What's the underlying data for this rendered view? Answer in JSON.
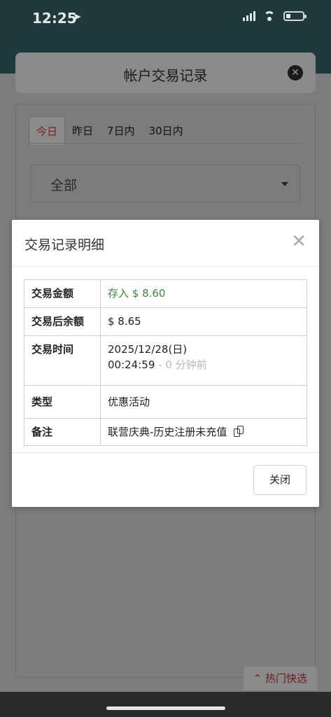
{
  "status_bar": {
    "time": "12:25",
    "location_icon": "location-arrow-icon"
  },
  "background": {
    "title": "帐户交易记录",
    "tabs": [
      {
        "label": "今日",
        "active": true
      },
      {
        "label": "昨日",
        "active": false
      },
      {
        "label": "7日内",
        "active": false
      },
      {
        "label": "30日内",
        "active": false
      }
    ],
    "filter": {
      "selected": "全部"
    },
    "hot_button": "热门快选"
  },
  "modal": {
    "title": "交易记录明细",
    "rows": {
      "amount": {
        "label": "交易金额",
        "value": "存入 $ 8.60"
      },
      "balance": {
        "label": "交易后余额",
        "value": "$ 8.65"
      },
      "time": {
        "label": "交易时间",
        "date": "2025/12/28(日)",
        "clock": "00:24:59",
        "ago": " - 0 分钟前"
      },
      "type": {
        "label": "类型",
        "value": "优惠活动"
      },
      "note": {
        "label": "备注",
        "value": "联营庆典-历史注册未充值"
      }
    },
    "close_label": "关闭"
  },
  "colors": {
    "deposit_green": "#3a8a3a",
    "active_tab_red": "#7a1f1f",
    "header_dark": "#1f3a3d"
  }
}
